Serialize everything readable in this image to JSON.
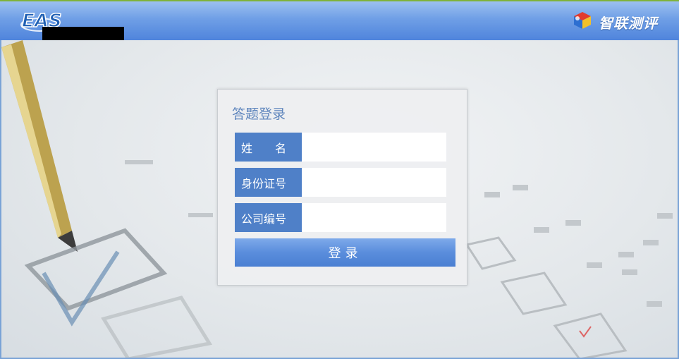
{
  "header": {
    "logo_text": "EAS",
    "brand_name": "智联测评"
  },
  "login": {
    "title": "答题登录",
    "fields": [
      {
        "label": "姓　　名",
        "value": "",
        "placeholder": ""
      },
      {
        "label": "身份证号",
        "value": "",
        "placeholder": ""
      },
      {
        "label": "公司编号",
        "value": "",
        "placeholder": ""
      }
    ],
    "submit_label": "登录"
  },
  "colors": {
    "header_blue": "#4f84dc",
    "label_blue": "#4f80c8",
    "title_blue": "#5f86bd"
  }
}
